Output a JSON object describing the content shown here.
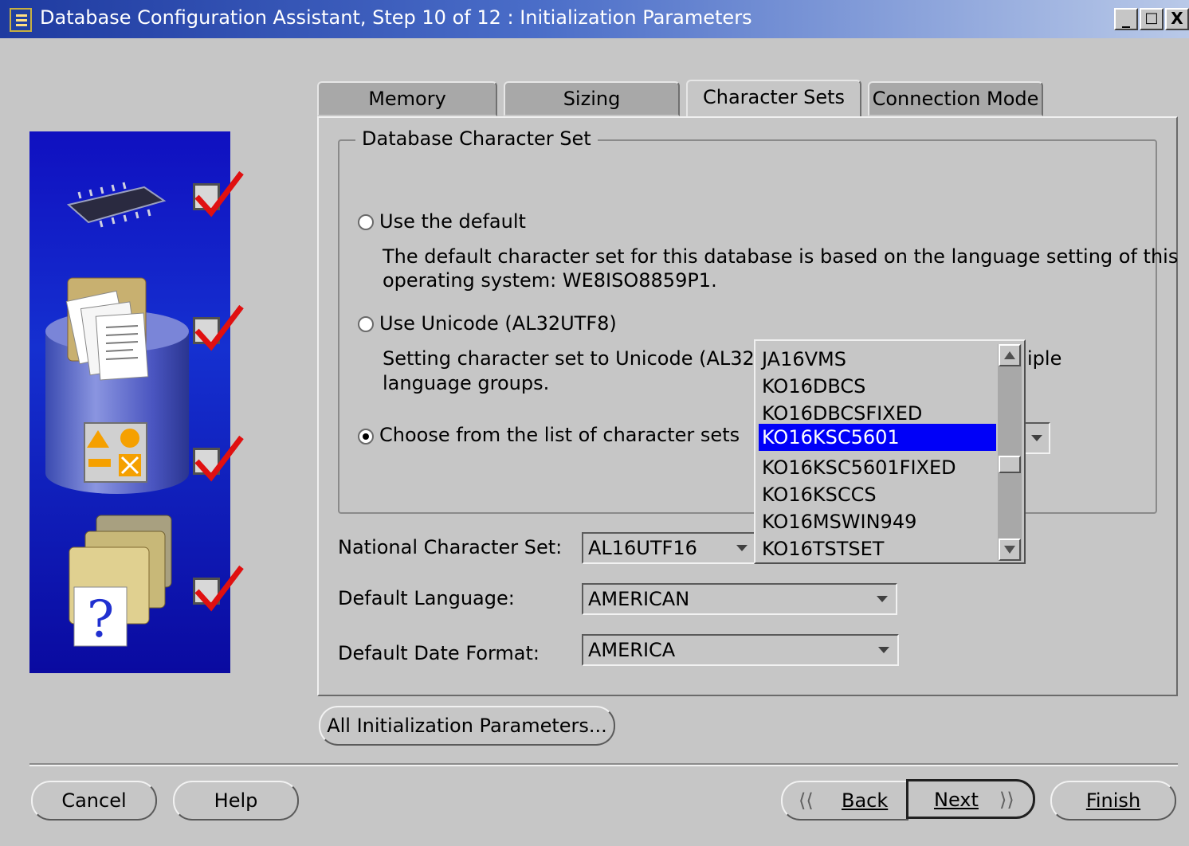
{
  "window": {
    "title": "Database Configuration Assistant, Step 10 of 12 : Initialization Parameters",
    "minimize": "_",
    "maximize": "□",
    "close": "X"
  },
  "tabs": [
    {
      "label": "Memory",
      "active": false
    },
    {
      "label": "Sizing",
      "active": false
    },
    {
      "label": "Character Sets",
      "active": true
    },
    {
      "label": "Connection Mode",
      "active": false
    }
  ],
  "database_charset": {
    "legend": "Database Character Set",
    "use_default_label": "Use the default",
    "default_desc_line1": "The default character set for this database is based on the language setting of this",
    "default_desc_line2": "operating system: WE8ISO8859P1.",
    "use_unicode_label": "Use Unicode (AL32UTF8)",
    "unicode_desc_line1_visible": "Setting character set to Unicode (AL32UT",
    "unicode_desc_line1_tail": "iple",
    "unicode_desc_line2": "language groups.",
    "choose_label": "Choose from the list of character sets",
    "selected_option": "choose"
  },
  "charset_dropdown": {
    "items": [
      "JA16VMS",
      "KO16DBCS",
      "KO16DBCSFIXED",
      "KO16KSC5601",
      "KO16KSC5601FIXED",
      "KO16KSCCS",
      "KO16MSWIN949",
      "KO16TSTSET"
    ],
    "selected": "KO16KSC5601"
  },
  "national_charset": {
    "label": "National Character Set:",
    "value": "AL16UTF16"
  },
  "default_language": {
    "label": "Default Language:",
    "value": "AMERICAN"
  },
  "default_date_format": {
    "label": "Default Date Format:",
    "value": "AMERICA"
  },
  "buttons": {
    "all_params": "All Initialization Parameters...",
    "cancel": "Cancel",
    "help": "Help",
    "back": "Back",
    "next": "Next",
    "finish": "Finish"
  },
  "colors": {
    "selection": "#0000f8",
    "dialog_bg": "#c6c6c6",
    "check": "#e01010"
  },
  "icons": [
    "memory-chip-icon",
    "folder-documents-icon",
    "shapes-icon",
    "help-document-icon",
    "checkmark-icon"
  ]
}
